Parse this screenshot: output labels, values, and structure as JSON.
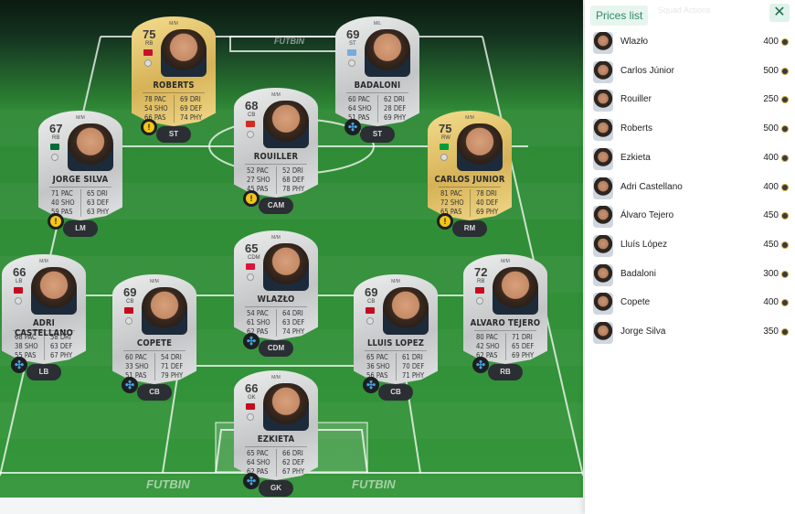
{
  "brand": {
    "watermark": "FUTBIN"
  },
  "panel": {
    "title": "Prices list",
    "close_icon": "close-icon",
    "background_tab": "Squad Actions",
    "players": [
      {
        "name": "Wlazło",
        "price": "400"
      },
      {
        "name": "Carlos Júnior",
        "price": "500"
      },
      {
        "name": "Rouiller",
        "price": "250"
      },
      {
        "name": "Roberts",
        "price": "500"
      },
      {
        "name": "Ezkieta",
        "price": "400"
      },
      {
        "name": "Adri Castellano",
        "price": "400"
      },
      {
        "name": "Álvaro Tejero",
        "price": "450"
      },
      {
        "name": "Lluís López",
        "price": "450"
      },
      {
        "name": "Badaloni",
        "price": "300"
      },
      {
        "name": "Copete",
        "price": "400"
      },
      {
        "name": "Jorge Silva",
        "price": "350"
      }
    ]
  },
  "cards": [
    {
      "id": "roberts",
      "tier": "gold",
      "top": "M/M",
      "rating": "75",
      "pos": "RB",
      "name": "ROBERTS",
      "stats": [
        "78 PAC",
        "54 SHO",
        "66 PAS",
        "69 DRI",
        "69 DEF",
        "74 PHY"
      ],
      "slot": "ST",
      "chem": "warn",
      "flag": "#c8102e"
    },
    {
      "id": "badaloni",
      "tier": "silver",
      "top": "M/L",
      "rating": "69",
      "pos": "ST",
      "name": "BADALONI",
      "stats": [
        "60 PAC",
        "64 SHO",
        "51 PAS",
        "62 DRI",
        "28 DEF",
        "69 PHY"
      ],
      "slot": "ST",
      "chem": "blue",
      "flag": "#74acdf"
    },
    {
      "id": "jorge-silva",
      "tier": "silver",
      "top": "M/M",
      "rating": "67",
      "pos": "RB",
      "name": "JORGE SILVA",
      "stats": [
        "71 PAC",
        "40 SHO",
        "59 PAS",
        "65 DRI",
        "63 DEF",
        "63 PHY"
      ],
      "slot": "LM",
      "chem": "warn",
      "flag": "#046a38"
    },
    {
      "id": "rouiller",
      "tier": "silver",
      "top": "M/M",
      "rating": "68",
      "pos": "CB",
      "name": "ROUILLER",
      "stats": [
        "52 PAC",
        "27 SHO",
        "45 PAS",
        "52 DRI",
        "68 DEF",
        "78 PHY"
      ],
      "slot": "CAM",
      "chem": "warn",
      "flag": "#d52b1e"
    },
    {
      "id": "carlos-junior",
      "tier": "gold",
      "top": "M/M",
      "rating": "75",
      "pos": "RW",
      "name": "CARLOS JUNIOR",
      "stats": [
        "81 PAC",
        "72 SHO",
        "65 PAS",
        "78 DRI",
        "40 DEF",
        "69 PHY"
      ],
      "slot": "RM",
      "chem": "warn",
      "flag": "#009c3b"
    },
    {
      "id": "adri-castellano",
      "tier": "silver",
      "top": "M/M",
      "rating": "66",
      "pos": "LB",
      "name": "ADRI CASTELLANO",
      "stats": [
        "68 PAC",
        "38 SHO",
        "55 PAS",
        "58 DRI",
        "63 DEF",
        "67 PHY"
      ],
      "slot": "LB",
      "chem": "blue",
      "flag": "#c60b1e"
    },
    {
      "id": "wlazlo",
      "tier": "silver",
      "top": "M/M",
      "rating": "65",
      "pos": "CDM",
      "name": "WLAZŁO",
      "stats": [
        "54 PAC",
        "61 SHO",
        "62 PAS",
        "64 DRI",
        "63 DEF",
        "74 PHY"
      ],
      "slot": "CDM",
      "chem": "blue",
      "flag": "#dc143c"
    },
    {
      "id": "alvaro-tejero",
      "tier": "silver",
      "top": "M/M",
      "rating": "72",
      "pos": "RB",
      "name": "ALVARO TEJERO",
      "stats": [
        "80 PAC",
        "42 SHO",
        "62 PAS",
        "71 DRI",
        "65 DEF",
        "69 PHY"
      ],
      "slot": "RB",
      "chem": "blue",
      "flag": "#c60b1e"
    },
    {
      "id": "copete",
      "tier": "silver",
      "top": "M/M",
      "rating": "69",
      "pos": "CB",
      "name": "COPETE",
      "stats": [
        "60 PAC",
        "33 SHO",
        "51 PAS",
        "54 DRI",
        "71 DEF",
        "79 PHY"
      ],
      "slot": "CB",
      "chem": "blue",
      "flag": "#c60b1e"
    },
    {
      "id": "lluis-lopez",
      "tier": "silver",
      "top": "M/M",
      "rating": "69",
      "pos": "CB",
      "name": "LLUIS LOPEZ",
      "stats": [
        "65 PAC",
        "36 SHO",
        "56 PAS",
        "61 DRI",
        "70 DEF",
        "71 PHY"
      ],
      "slot": "CB",
      "chem": "blue",
      "flag": "#c60b1e"
    },
    {
      "id": "ezkieta",
      "tier": "silver",
      "top": "M/M",
      "rating": "66",
      "pos": "GK",
      "name": "EZKIETA",
      "stats": [
        "65 PAC",
        "64 SHO",
        "62 PAS",
        "66 DRI",
        "62 DEF",
        "67 PHY"
      ],
      "slot": "GK",
      "chem": "blue",
      "flag": "#c60b1e"
    }
  ]
}
